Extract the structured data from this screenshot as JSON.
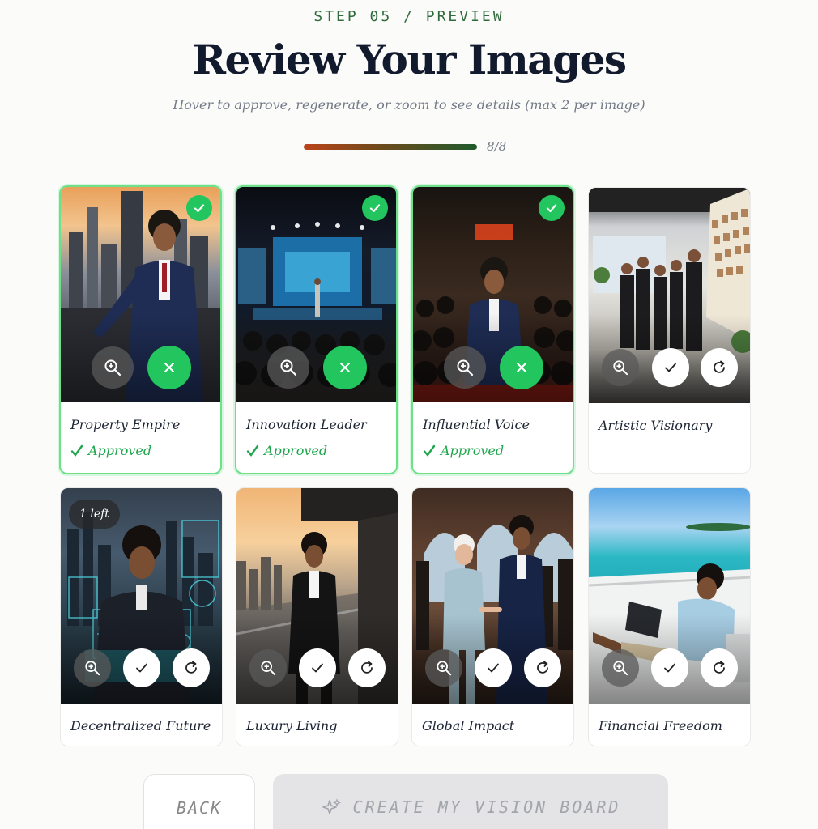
{
  "header": {
    "step": "STEP 05 / PREVIEW",
    "title": "Review Your Images",
    "subtitle": "Hover to approve, regenerate, or zoom to see details (max 2 per image)",
    "progress_text": "8/8",
    "progress_fraction": 1.0
  },
  "cards": [
    {
      "label": "Property Empire",
      "status": "Approved"
    },
    {
      "label": "Innovation Leader",
      "status": "Approved"
    },
    {
      "label": "Influential Voice",
      "status": "Approved"
    },
    {
      "label": "Artistic Visionary",
      "status": ""
    },
    {
      "label": "Decentralized Future",
      "status": "",
      "badge": "1 left"
    },
    {
      "label": "Luxury Living",
      "status": ""
    },
    {
      "label": "Global Impact",
      "status": ""
    },
    {
      "label": "Financial Freedom",
      "status": ""
    }
  ],
  "footer": {
    "back_label": "BACK",
    "create_label": "CREATE MY VISION BOARD"
  },
  "colors": {
    "approved_green": "#22c55e",
    "progress_start": "#bb4419",
    "progress_end": "#1f5a2d"
  },
  "icons": {
    "zoom": "zoom-in-icon",
    "approve": "check-icon",
    "reject": "close-icon",
    "regenerate": "refresh-icon",
    "create": "sparkle-icon"
  }
}
